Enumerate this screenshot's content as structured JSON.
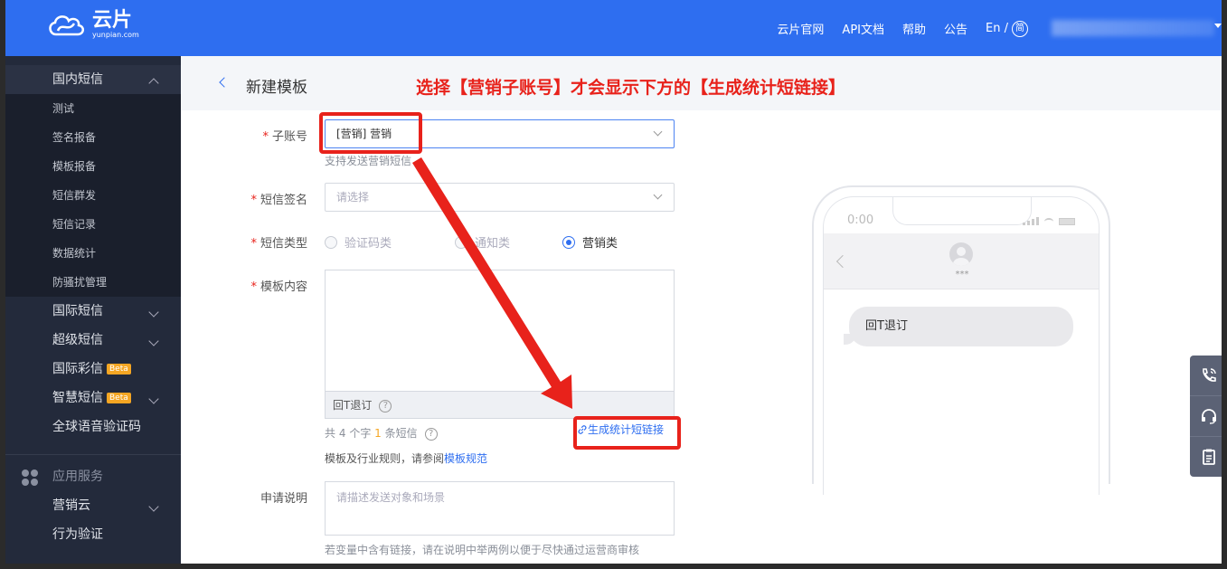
{
  "header": {
    "logo_cn": "云片",
    "logo_en": "yunpian.com",
    "nav": [
      "云片官网",
      "API文档",
      "帮助",
      "公告"
    ],
    "lang": "En /",
    "lang_icon": "简"
  },
  "sidebar": {
    "domestic": {
      "label": "国内短信",
      "items": [
        "测试",
        "签名报备",
        "模板报备",
        "短信群发",
        "短信记录",
        "数据统计",
        "防骚扰管理"
      ]
    },
    "groups": [
      {
        "label": "国际短信"
      },
      {
        "label": "超级短信"
      },
      {
        "label": "国际彩信",
        "badge": "Beta"
      },
      {
        "label": "智慧短信",
        "badge": "Beta"
      },
      {
        "label": "全球语音验证码"
      }
    ],
    "section": "应用服务",
    "app_items": [
      {
        "label": "营销云"
      },
      {
        "label": "行为验证"
      }
    ]
  },
  "page": {
    "title": "新建模板",
    "annotation": "选择【营销子账号】才会显示下方的【生成统计短链接】"
  },
  "form": {
    "subaccount": {
      "label": "子账号",
      "value": "[营销] 营销",
      "hint": "支持发送营销短信"
    },
    "signature": {
      "label": "短信签名",
      "placeholder": "请选择"
    },
    "type": {
      "label": "短信类型",
      "options": [
        "验证码类",
        "通知类",
        "营销类"
      ],
      "selected": "营销类"
    },
    "content": {
      "label": "模板内容",
      "footer_text": "回T退订",
      "help_icon": "?"
    },
    "count": {
      "prefix": "共",
      "chars": "4",
      "mid": "个字",
      "msgs": "1",
      "suffix": "条短信",
      "help_icon": "?"
    },
    "rule": {
      "text": "模板及行业规则，请参阅",
      "link": "模板规范"
    },
    "generate_link": "生成统计短链接",
    "description": {
      "label": "申请说明",
      "placeholder": "请描述发送对象和场景",
      "hint": "若变量中含有链接，请在说明中举两例以便于尽快通过运营商审核"
    }
  },
  "phone": {
    "time": "0:00",
    "contact": "***",
    "message": "回T退订"
  },
  "colors": {
    "brand": "#2e6ef0",
    "sidebar": "#232a3b",
    "annotation": "#e8221b",
    "badge": "#f5a623"
  }
}
